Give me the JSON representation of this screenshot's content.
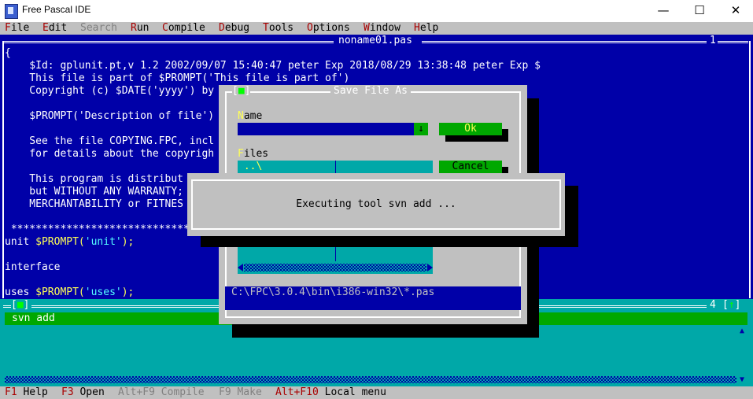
{
  "window": {
    "title": "Free Pascal IDE",
    "minimize": "—",
    "maximize": "☐",
    "close": "✕"
  },
  "menu": [
    {
      "hotkey": "F",
      "rest": "ile",
      "enabled": true
    },
    {
      "hotkey": "E",
      "rest": "dit",
      "enabled": true
    },
    {
      "hotkey": "",
      "rest": "Search",
      "enabled": false
    },
    {
      "hotkey": "R",
      "rest": "un",
      "enabled": true
    },
    {
      "hotkey": "C",
      "rest": "ompile",
      "enabled": true
    },
    {
      "hotkey": "D",
      "rest": "ebug",
      "enabled": true
    },
    {
      "hotkey": "T",
      "rest": "ools",
      "enabled": true
    },
    {
      "hotkey": "O",
      "rest": "ptions",
      "enabled": true
    },
    {
      "hotkey": "W",
      "rest": "indow",
      "enabled": true
    },
    {
      "hotkey": "H",
      "rest": "elp",
      "enabled": true
    }
  ],
  "editor": {
    "title": "noname01.pas",
    "number": "1",
    "lines": [
      [
        {
          "t": "{"
        }
      ],
      [
        {
          "t": "    $Id: gplunit.pt,v 1.2 2002/09/07 15:40:47 peter Exp 2018/08/29 13:38:48 peter Exp $"
        }
      ],
      [
        {
          "t": "    This file is part of $PROMPT('This file is part of')"
        }
      ],
      [
        {
          "t": "    Copyright (c) $DATE('yyyy') by"
        }
      ],
      [
        {
          "t": ""
        }
      ],
      [
        {
          "t": "    $PROMPT('Description of file')"
        }
      ],
      [
        {
          "t": ""
        }
      ],
      [
        {
          "t": "    See the file COPYING.FPC, incl"
        }
      ],
      [
        {
          "t": "    for details about the copyrigh"
        }
      ],
      [
        {
          "t": ""
        }
      ],
      [
        {
          "t": "    This program is distribut"
        }
      ],
      [
        {
          "t": "    but WITHOUT ANY WARRANTY;"
        }
      ],
      [
        {
          "t": "    MERCHANTABILITY or FITNES"
        }
      ],
      [
        {
          "t": ""
        }
      ],
      [
        {
          "t": " *****************************"
        }
      ],
      [
        {
          "t": "unit "
        },
        {
          "t": "$PROMPT(",
          "c": "sym"
        },
        {
          "t": "'unit'",
          "c": "str"
        },
        {
          "t": ");",
          "c": "sym"
        }
      ],
      [
        {
          "t": ""
        }
      ],
      [
        {
          "t": "interface"
        }
      ],
      [
        {
          "t": ""
        }
      ],
      [
        {
          "t": "uses "
        },
        {
          "t": "$PROMPT(",
          "c": "sym"
        },
        {
          "t": "'uses'",
          "c": "str"
        },
        {
          "t": ");",
          "c": "sym"
        }
      ]
    ]
  },
  "messages": {
    "close_glyph": "■",
    "number": "4",
    "zoom_glyph": "↑",
    "line": "svn add",
    "scroll_up": "▲",
    "scroll_down": "▼"
  },
  "save_dialog": {
    "title": "Save File As",
    "close_glyph": "■",
    "name_label_hotkey": "N",
    "name_label_rest": "ame",
    "history_glyph": "↓",
    "ok_label": "Ok",
    "files_label_hotkey": "F",
    "files_label_rest": "iles",
    "file_item": " ..\\",
    "cancel_label": "Cancel",
    "path": "C:\\FPC\\3.0.4\\bin\\i386-win32\\*.pas"
  },
  "exec_dialog": {
    "text": "Executing tool svn add ..."
  },
  "status": [
    {
      "key": "F1",
      "label": " Help",
      "enabled": true
    },
    {
      "key": "F3",
      "label": " Open",
      "enabled": true
    },
    {
      "key": "Alt+F9",
      "label": " Compile",
      "enabled": false
    },
    {
      "key": "F9",
      "label": " Make",
      "enabled": false
    },
    {
      "key": "Alt+F10",
      "label": " Local menu",
      "enabled": true
    }
  ],
  "colors": {
    "editor_bg": "#0000a8",
    "dialog_bg": "#c0c0c0",
    "messages_bg": "#00a8a8",
    "highlight_green": "#00a800",
    "hotkey_red": "#a80000"
  }
}
